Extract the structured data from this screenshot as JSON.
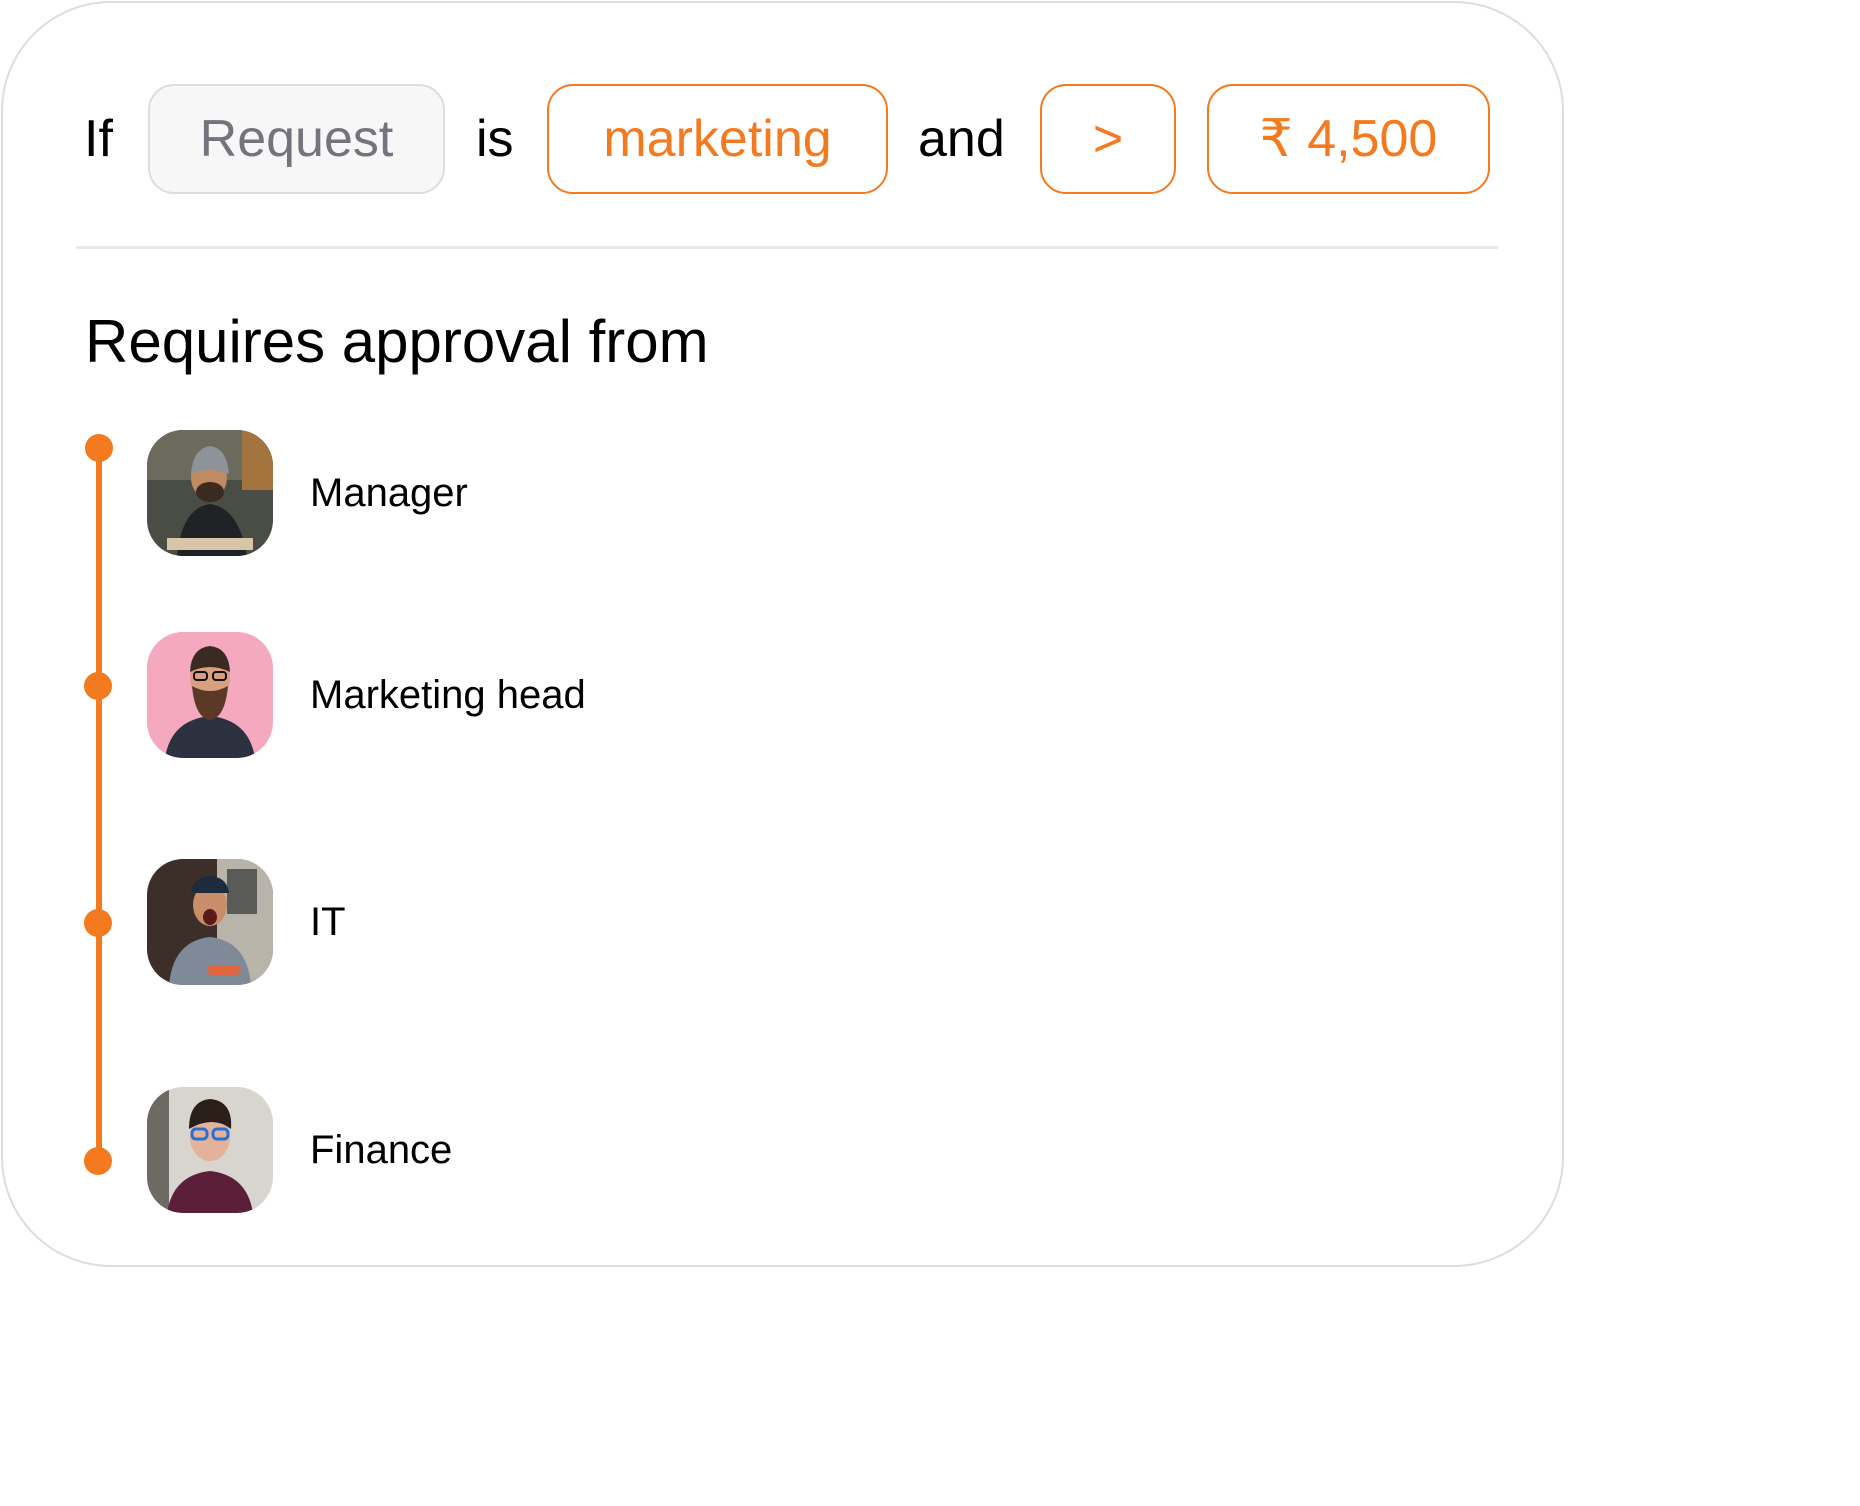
{
  "rule": {
    "if_word": "If",
    "field": "Request",
    "is_word": "is",
    "category": "marketing",
    "and_word": "and",
    "operator": ">",
    "amount": "₹ 4,500"
  },
  "approval": {
    "heading": "Requires approval from",
    "approvers": [
      {
        "label": "Manager",
        "avatar_bg": "#4a4d45"
      },
      {
        "label": "Marketing head",
        "avatar_bg": "#f4a9bf"
      },
      {
        "label": "IT",
        "avatar_bg": "#3c2f2a"
      },
      {
        "label": "Finance",
        "avatar_bg": "#d8d5cf"
      }
    ]
  },
  "colors": {
    "accent": "#f47a1f",
    "neutral_border": "#dddde0",
    "neutral_text": "#75747c",
    "card_border": "#d9dee6"
  }
}
